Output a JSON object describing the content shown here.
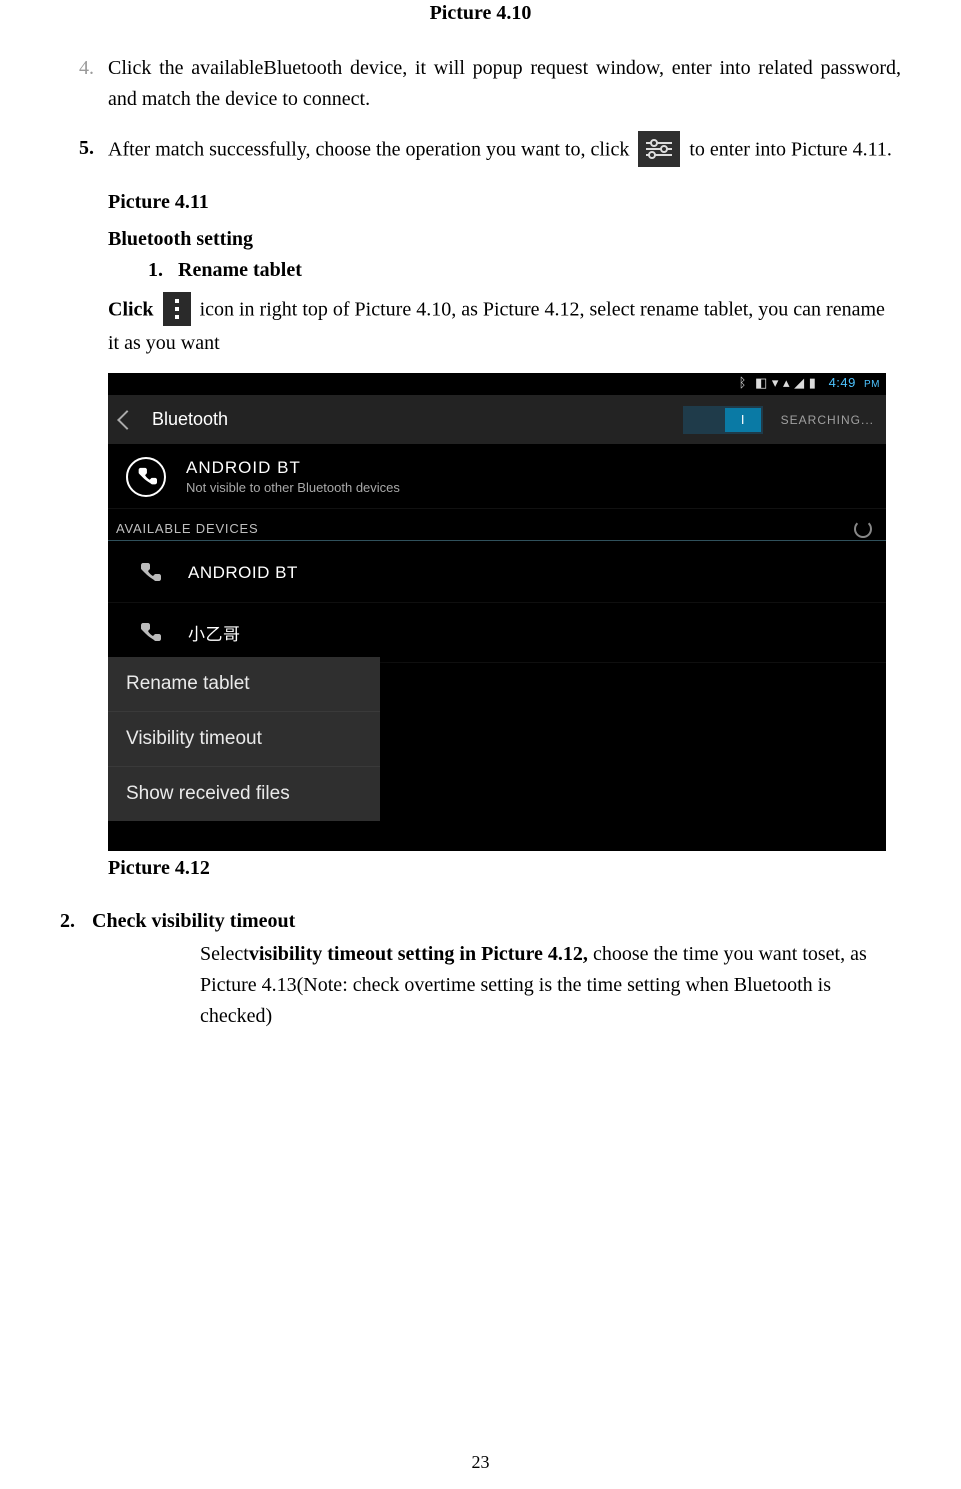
{
  "caption_top": "Picture 4.10",
  "step4_num": "4.",
  "step4_text": "Click the availableBluetooth device, it will popup request window, enter into related password, and match the device to connect.",
  "step5_num": "5.    ",
  "step5_pre": "After match successfully, choose the operation you want to, click ",
  "step5_post": " to enter into Picture 4.11.",
  "pic411_label": "Picture 4.11",
  "bt_setting_label": "Bluetooth setting",
  "sub1_num": "1.",
  "sub1_label": "Rename tablet",
  "click_pre": "Click ",
  "click_post": " icon in right top of Picture 4.10, as Picture 4.12, select rename tablet, you can rename it as you want",
  "shot": {
    "status_icons": "◧  ▾ ▴ ◢ ▮",
    "clock": "4:49",
    "ampm": "PM",
    "title": "Bluetooth",
    "toggle_knob": "I",
    "searching": "SEARCHING...",
    "mydev_title": "ANDROID BT",
    "mydev_sub": "Not visible to other Bluetooth devices",
    "section_label": "AVAILABLE DEVICES",
    "dev1": "ANDROID BT",
    "dev2": "小乙哥",
    "menu1": "Rename tablet",
    "menu2": "Visibility timeout",
    "menu3": "Show received files"
  },
  "caption_under": "Picture 4.12",
  "item2_num": "2.",
  "item2_head": "Check visibility timeout",
  "item2_body_pre": "Select",
  "item2_body_bold": "visibility timeout setting in Picture 4.12, ",
  "item2_body_post": "choose the time you want toset, as Picture 4.13(Note: check overtime setting is the time setting when Bluetooth is checked)",
  "page_num": "23"
}
